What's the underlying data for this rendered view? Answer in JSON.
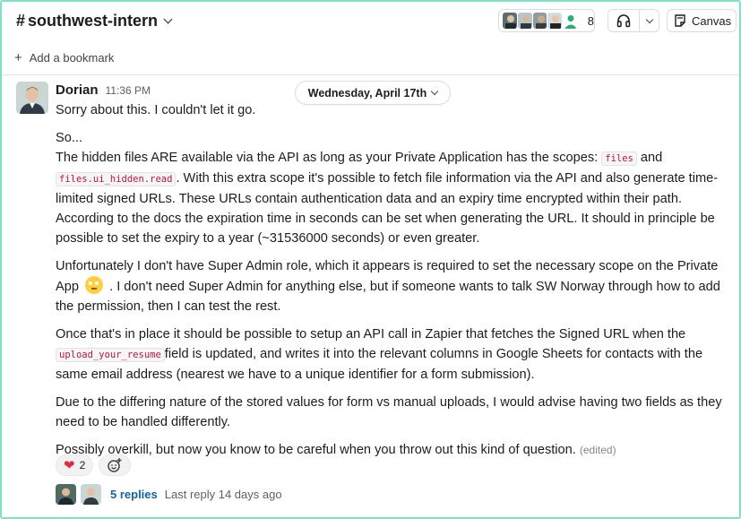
{
  "header": {
    "channel_hash": "#",
    "channel_name": "southwest-intern",
    "member_count": "8",
    "canvas_label": "Canvas"
  },
  "bookmark": {
    "plus": "+",
    "label": "Add a bookmark"
  },
  "message": {
    "author": "Dorian",
    "time": "11:36 PM",
    "date_divider": "Wednesday, April 17th",
    "paragraphs": {
      "p1": "Sorry about this. I couldn't let it go.",
      "p2": "So...",
      "p3a": "The hidden files ARE available via the API as long as your Private Application has the scopes: ",
      "p3_code1": "files",
      "p3b": " and ",
      "p3_code2": "files.ui_hidden.read",
      "p3c": ". With this extra scope it's possible to fetch file information via the API and also generate time-limited signed URLs. These URLs contain authentication data and an expiry time encrypted within their path. According to the docs the expiration time in seconds can be set when generating the URL. It should in principle be possible to set the expiry to a year (~31536000 seconds) or even greater.",
      "p4a": "Unfortunately I don't have Super Admin role, which it appears is required to set the necessary scope on the Private App",
      "p4b": " . I don't need Super Admin for anything else, but if someone wants to talk SW Norway through how to add the permission, then I can test the rest.",
      "p5a": "Once that's in place it should be possible to setup an API call in Zapier that fetches the Signed URL when the ",
      "p5_code": "upload_your_resume",
      "p5b": "field is updated, and writes it into the relevant columns in Google Sheets for contacts with the same email address (nearest we have to a unique identifier for a form submission).",
      "p6": "Due to the differing nature of the stored values for form vs manual uploads, I would advise having two fields as they need to be handled differently.",
      "p7": " Possibly overkill, but now you know to be careful when you throw out this kind of question.",
      "edited": "(edited)"
    },
    "reactions": [
      {
        "icon": "heart-icon",
        "count": "2"
      }
    ],
    "thread": {
      "replies": "5 replies",
      "last_reply": "Last reply 14 days ago"
    }
  },
  "colors": {
    "border_accent": "#7fe0c6",
    "link_blue": "#1264a3",
    "code_red": "#c01343",
    "heart": "#dd2e44"
  }
}
